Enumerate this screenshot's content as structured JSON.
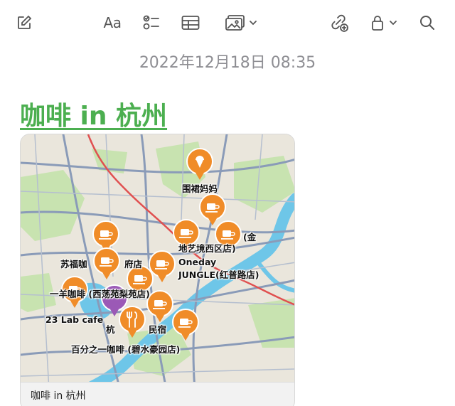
{
  "toolbar": {
    "compose_icon": "compose-icon",
    "format_label": "Aa",
    "checklist_icon": "checklist-icon",
    "table_icon": "table-icon",
    "media_icon": "photo-icon",
    "collab_icon": "collaborate-icon",
    "lock_icon": "lock-icon",
    "search_icon": "search-icon"
  },
  "note": {
    "timestamp": "2022年12月18日 08:35",
    "title": "咖啡 in 杭州"
  },
  "map": {
    "caption": "咖啡 in 杭州",
    "labels": [
      "围裙妈妈",
      "(金",
      "地艺境西区店)",
      "苏福咖",
      "府店",
      "Oneday",
      "JUNGLE(红普路店)",
      "一羊咖啡 (西荡苑梨苑店)",
      "23 Lab cafe",
      "杭",
      "民宿",
      "百分之一咖啡 (碧水豪园店)"
    ],
    "colors": {
      "pin": "#f08c28",
      "restaurant_pin": "#9b59b6",
      "water": "#6ec6e8",
      "land": "#eae6dc",
      "park": "#c8e3b0"
    }
  }
}
